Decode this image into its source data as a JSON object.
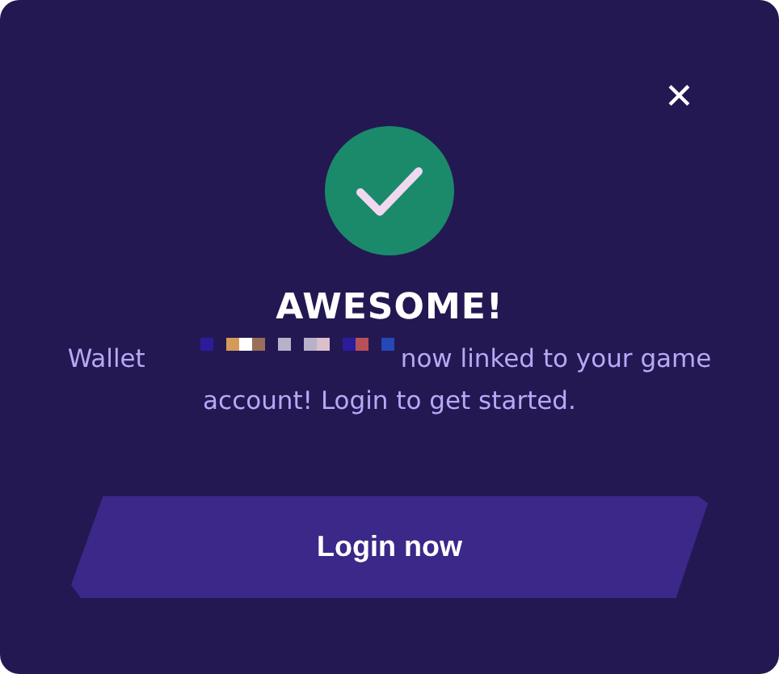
{
  "dialog": {
    "close": "✕",
    "title": "AWESOME!",
    "message": {
      "lead": "Wallet",
      "rest": "now linked to your game account! Login to get started."
    },
    "button": "Login now"
  }
}
